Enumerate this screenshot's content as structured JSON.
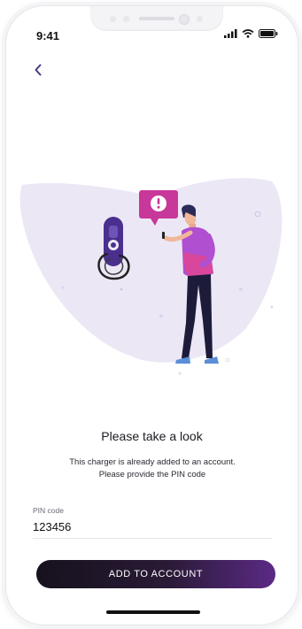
{
  "status_bar": {
    "time": "9:41"
  },
  "content": {
    "title": "Please take a look",
    "description": "This charger is already added to an account. Please provide the PIN code"
  },
  "pin_field": {
    "label": "PIN code",
    "value": "123456"
  },
  "actions": {
    "add_label": "ADD TO ACCOUNT"
  },
  "icons": {
    "back": "chevron-left-icon",
    "alert": "exclamation-icon",
    "signal": "signal-icon",
    "wifi": "wifi-icon",
    "battery": "battery-icon"
  },
  "colors": {
    "accent": "#5b3d91",
    "bubble": "#c8379a",
    "blob": "#ece7f5",
    "button_start": "#16121d",
    "button_end": "#5b2a86"
  }
}
